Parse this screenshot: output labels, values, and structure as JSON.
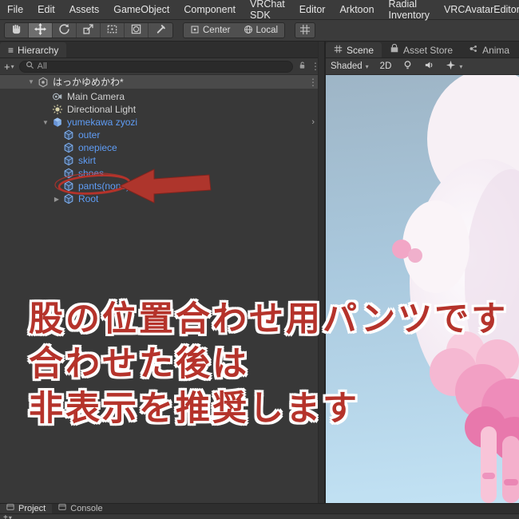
{
  "icons": {
    "caret_down": "▾",
    "menu_dots": "⋮",
    "hamburger": "≡",
    "plus": "+",
    "tri_down": "▼",
    "tri_right": "▶",
    "chevron_right": "›"
  },
  "colors": {
    "prefab_blue": "#5f9df6",
    "annotation_red": "#b5332b",
    "annotation_outline": "#ffffff",
    "arrow_red": "#ae352c"
  },
  "menu_bar": {
    "items": [
      "File",
      "Edit",
      "Assets",
      "GameObject",
      "Component",
      "VRChat SDK",
      "Editor",
      "Arktoon",
      "Radial Inventory",
      "VRCAvatarEditor"
    ]
  },
  "toolbar": {
    "center": "Center",
    "local": "Local"
  },
  "hierarchy": {
    "tab": "Hierarchy",
    "search_placeholder": "All",
    "scene": {
      "name": "はっかゆめかわ*"
    },
    "items": [
      {
        "label": "Main Camera",
        "type": "gameobject"
      },
      {
        "label": "Directional Light",
        "type": "gameobject"
      },
      {
        "label": "yumekawa zyozi",
        "type": "prefab-root",
        "expanded": true
      },
      {
        "label": "outer",
        "type": "prefab-child"
      },
      {
        "label": "onepiece",
        "type": "prefab-child"
      },
      {
        "label": "skirt",
        "type": "prefab-child"
      },
      {
        "label": "shoes",
        "type": "prefab-child"
      },
      {
        "label": "pants(none)",
        "type": "prefab-child",
        "annotated": true
      },
      {
        "label": "Root",
        "type": "prefab-child",
        "collapsed": true
      }
    ]
  },
  "scene_view": {
    "tabs": [
      {
        "label": "Scene",
        "active": true
      },
      {
        "label": "Asset Store",
        "active": false
      },
      {
        "label": "Anima",
        "active": false
      }
    ],
    "shading": "Shaded",
    "toggle_2d": "2D"
  },
  "annotation": {
    "lines": [
      "股の位置合わせ用パンツです",
      "合わせた後は",
      "非表示を推奨します"
    ]
  },
  "bottom": {
    "tabs": [
      {
        "label": "Project",
        "active": true
      },
      {
        "label": "Console",
        "active": false
      }
    ]
  }
}
